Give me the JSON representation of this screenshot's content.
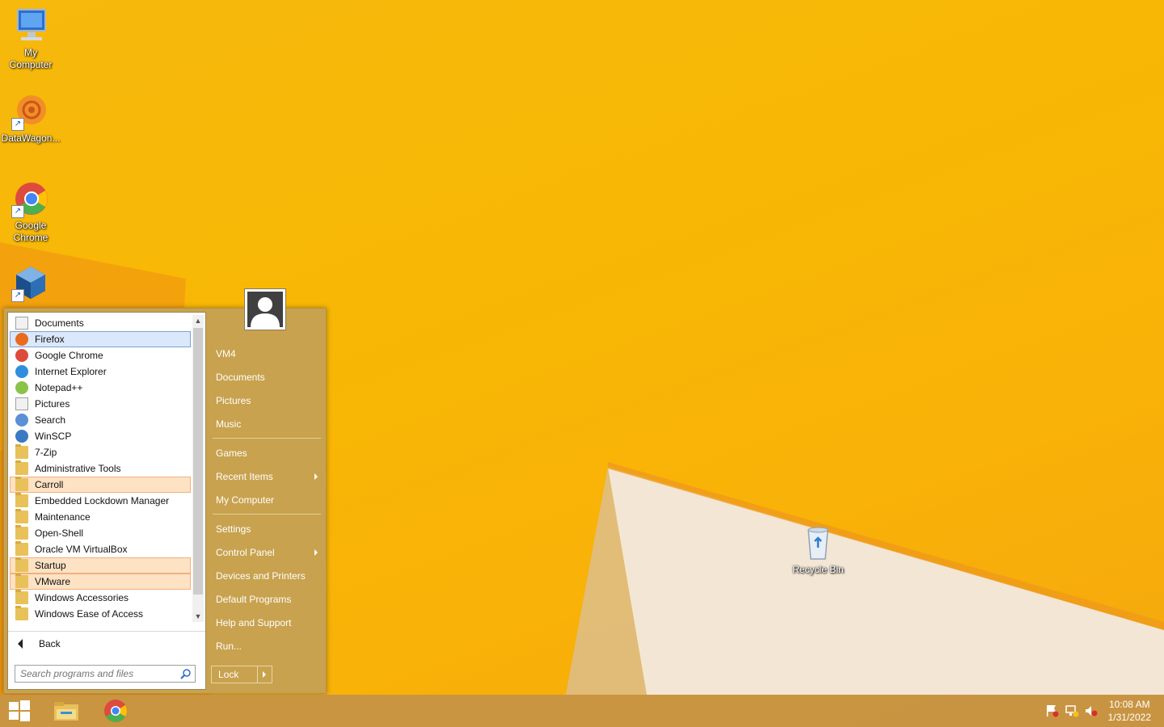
{
  "desktop": {
    "icons": [
      {
        "label": "My\nComputer",
        "icon": "computer-icon"
      },
      {
        "label": "DataWagon...",
        "icon": "datawagon-icon"
      },
      {
        "label": "Google\nChrome",
        "icon": "chrome-icon"
      },
      {
        "label": "",
        "icon": "virtualbox-icon"
      },
      {
        "label": "Recycle Bin",
        "icon": "recycle-bin-icon"
      }
    ]
  },
  "start_menu": {
    "programs": [
      {
        "label": "Documents",
        "icon": "documents-icon"
      },
      {
        "label": "Firefox",
        "icon": "firefox-icon",
        "highlight": "blue"
      },
      {
        "label": "Google Chrome",
        "icon": "chrome-icon"
      },
      {
        "label": "Internet Explorer",
        "icon": "ie-icon"
      },
      {
        "label": "Notepad++",
        "icon": "notepad-icon"
      },
      {
        "label": "Pictures",
        "icon": "pictures-icon"
      },
      {
        "label": "Search",
        "icon": "search-icon"
      },
      {
        "label": "WinSCP",
        "icon": "winscp-icon"
      },
      {
        "label": "7-Zip",
        "icon": "folder-icon"
      },
      {
        "label": "Administrative Tools",
        "icon": "folder-icon"
      },
      {
        "label": "Carroll",
        "icon": "folder-icon",
        "highlight": "orange"
      },
      {
        "label": "Embedded Lockdown Manager",
        "icon": "folder-icon"
      },
      {
        "label": "Maintenance",
        "icon": "folder-icon"
      },
      {
        "label": "Open-Shell",
        "icon": "folder-icon"
      },
      {
        "label": "Oracle VM VirtualBox",
        "icon": "folder-icon"
      },
      {
        "label": "Startup",
        "icon": "folder-icon",
        "highlight": "orange"
      },
      {
        "label": "VMware",
        "icon": "folder-icon",
        "highlight": "orange"
      },
      {
        "label": "Windows Accessories",
        "icon": "folder-icon"
      },
      {
        "label": "Windows Ease of Access",
        "icon": "folder-icon"
      }
    ],
    "back_label": "Back",
    "search_placeholder": "Search programs and files",
    "right": {
      "user": "VM4",
      "documents": "Documents",
      "pictures": "Pictures",
      "music": "Music",
      "games": "Games",
      "recent_items": "Recent Items",
      "my_computer": "My Computer",
      "settings": "Settings",
      "control_panel": "Control Panel",
      "devices_printers": "Devices and Printers",
      "default_programs": "Default Programs",
      "help_support": "Help and Support",
      "run": "Run...",
      "lock": "Lock"
    }
  },
  "taskbar": {
    "time": "10:08 AM",
    "date": "1/31/2022"
  },
  "colors": {
    "wallpaper": "#f8b704",
    "menu_bg": "#c8a24e",
    "highlight_blue": "#dbe8fb",
    "highlight_orange": "#fde2c4"
  }
}
